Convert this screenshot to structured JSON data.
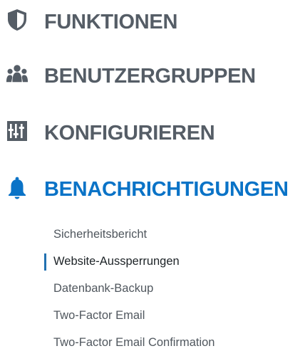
{
  "colors": {
    "nav_text": "#555d66",
    "active": "#0a73c7",
    "sub_text": "#50575e",
    "sub_current_text": "#1d2327",
    "indicator": "#2271b1"
  },
  "nav": {
    "items": [
      {
        "label": "FUNKTIONEN",
        "icon": "shield-icon"
      },
      {
        "label": "BENUTZERGRUPPEN",
        "icon": "user-group-icon"
      },
      {
        "label": "KONFIGURIEREN",
        "icon": "settings-sliders-icon"
      },
      {
        "label": "BENACHRICHTIGUNGEN",
        "icon": "bell-icon",
        "active": true
      }
    ]
  },
  "submenu": {
    "items": [
      {
        "label": "Sicherheitsbericht"
      },
      {
        "label": "Website-Aussperrungen",
        "current": true
      },
      {
        "label": "Datenbank-Backup"
      },
      {
        "label": "Two-Factor Email"
      },
      {
        "label": "Two-Factor Email Confirmation"
      }
    ]
  }
}
